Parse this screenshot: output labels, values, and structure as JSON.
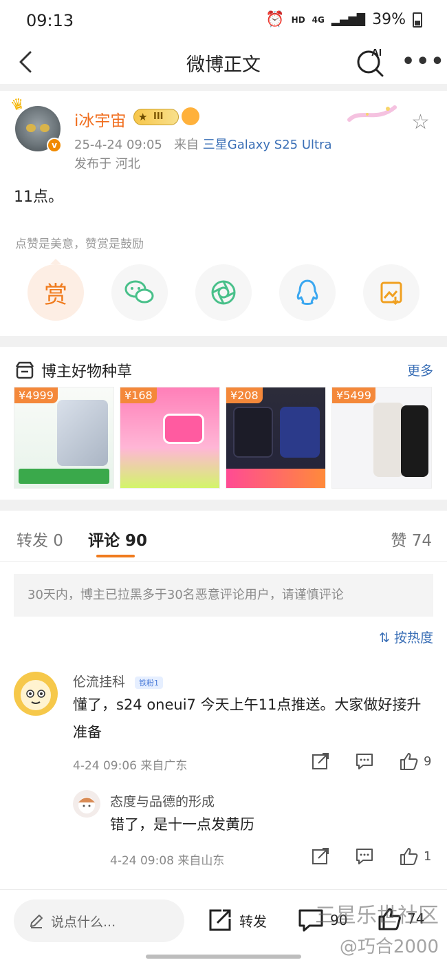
{
  "status_bar": {
    "time": "09:13",
    "hd": "HD",
    "network": "4G",
    "battery": "39%"
  },
  "nav": {
    "title": "微博正文",
    "ai_label": "AI"
  },
  "post": {
    "username": "i冰宇宙",
    "level": "III",
    "timestamp": "25-4-24 09:05",
    "source_prefix": "来自",
    "source": "三星Galaxy S25 Ultra",
    "location": "发布于 河北",
    "content": "11点。",
    "reward_hint": "点赞是美意，赞赏是鼓励",
    "reward_label": "赏",
    "share_icons": [
      "reward-icon",
      "wechat-icon",
      "moments-icon",
      "qq-icon",
      "save-image-icon"
    ]
  },
  "goods": {
    "title": "博主好物种草",
    "more": "更多",
    "items": [
      {
        "price": "¥4999"
      },
      {
        "price": "¥168"
      },
      {
        "price": "¥208"
      },
      {
        "price": "¥5499"
      }
    ]
  },
  "tabs": {
    "repost": "转发 0",
    "comments": "评论 90",
    "likes": "赞 74"
  },
  "notice": "30天内，博主已拉黑多于30名恶意评论用户，请谨慎评论",
  "sort_label": "按热度",
  "comments": [
    {
      "user": "伦流挂科",
      "badge": "铁粉1",
      "text": "懂了，s24 oneui7 今天上午11点推送。大家做好接升准备",
      "time": "4-24 09:06",
      "loc": "来自广东",
      "likes": "9"
    },
    {
      "user": "态度与品德的形成",
      "text": "错了，是十一点发黄历",
      "time": "4-24 09:08",
      "loc": "来自山东",
      "likes": "1"
    }
  ],
  "bottom": {
    "input_placeholder": "说点什么...",
    "repost": "转发",
    "comments": "90",
    "likes": "74"
  },
  "watermark": {
    "line1": "三星乐世社区",
    "line2": "@巧合2000"
  },
  "colors": {
    "accent": "#f07b1d",
    "link": "#3a6fb6",
    "username": "#f06d1d"
  }
}
